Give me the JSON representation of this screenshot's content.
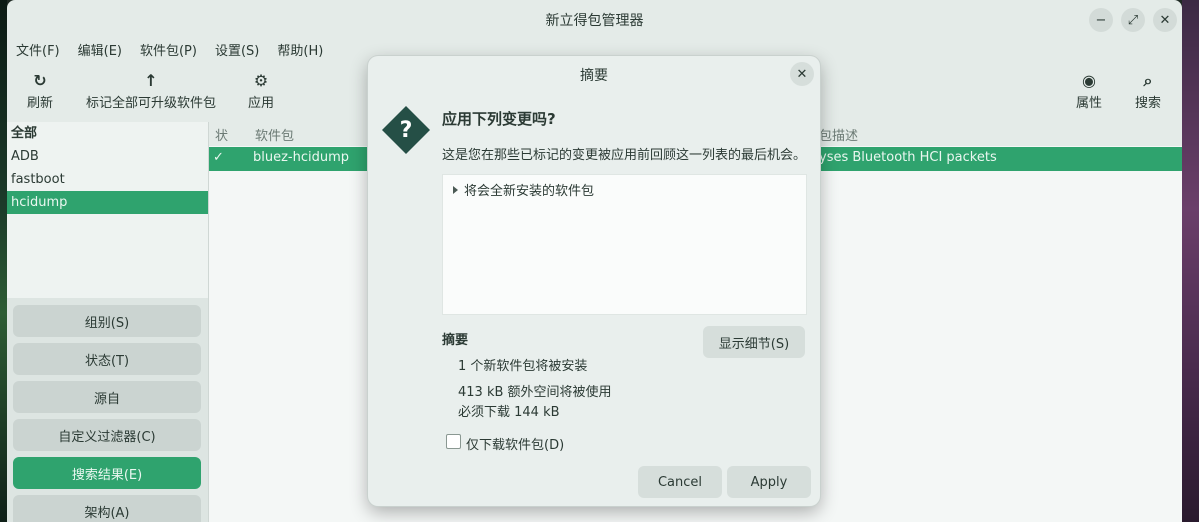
{
  "window": {
    "title": "新立得包管理器",
    "min_icon": "−",
    "max_icon": "⤢",
    "close_icon": "✕"
  },
  "menubar": [
    "文件(F)",
    "编辑(E)",
    "软件包(P)",
    "设置(S)",
    "帮助(H)"
  ],
  "toolbar": {
    "refresh": {
      "label": "刷新",
      "icon": "↻"
    },
    "mark_all": {
      "label": "标记全部可升级软件包",
      "icon": "↑"
    },
    "apply": {
      "label": "应用",
      "icon": "⚙"
    },
    "properties": {
      "label": "属性",
      "icon": "◉"
    },
    "search": {
      "label": "搜索",
      "icon": "⌕"
    }
  },
  "sidebar": {
    "items": [
      "全部",
      "ADB",
      "fastboot",
      "hcidump"
    ],
    "selected_index": 3
  },
  "filters": [
    "组别(S)",
    "状态(T)",
    "源自",
    "自定义过滤器(C)",
    "搜索结果(E)",
    "架构(A)"
  ],
  "table": {
    "headers": {
      "status": "状",
      "package": "软件包",
      "description": "包描述"
    },
    "rows": [
      {
        "status": "✓",
        "package": "bluez-hcidump",
        "description": "yses Bluetooth HCI packets"
      }
    ]
  },
  "dialog": {
    "title": "摘要",
    "close": "✕",
    "icon": "?",
    "heading": "应用下列变更吗?",
    "subtext": "这是您在那些已标记的变更被应用前回顾这一列表的最后机会。",
    "tree_item": "将会全新安装的软件包",
    "summary_title": "摘要",
    "show_details": "显示细节(S)",
    "summary_lines": [
      "1 个新软件包将被安装",
      "413 kB 额外空间将被使用",
      "必须下载 144 kB"
    ],
    "download_only": "仅下载软件包(D)",
    "cancel": "Cancel",
    "apply": "Apply"
  },
  "colors": {
    "accent": "#2fa36e",
    "window_bg": "#e4ebe8",
    "icon_diamond": "#254f46"
  }
}
